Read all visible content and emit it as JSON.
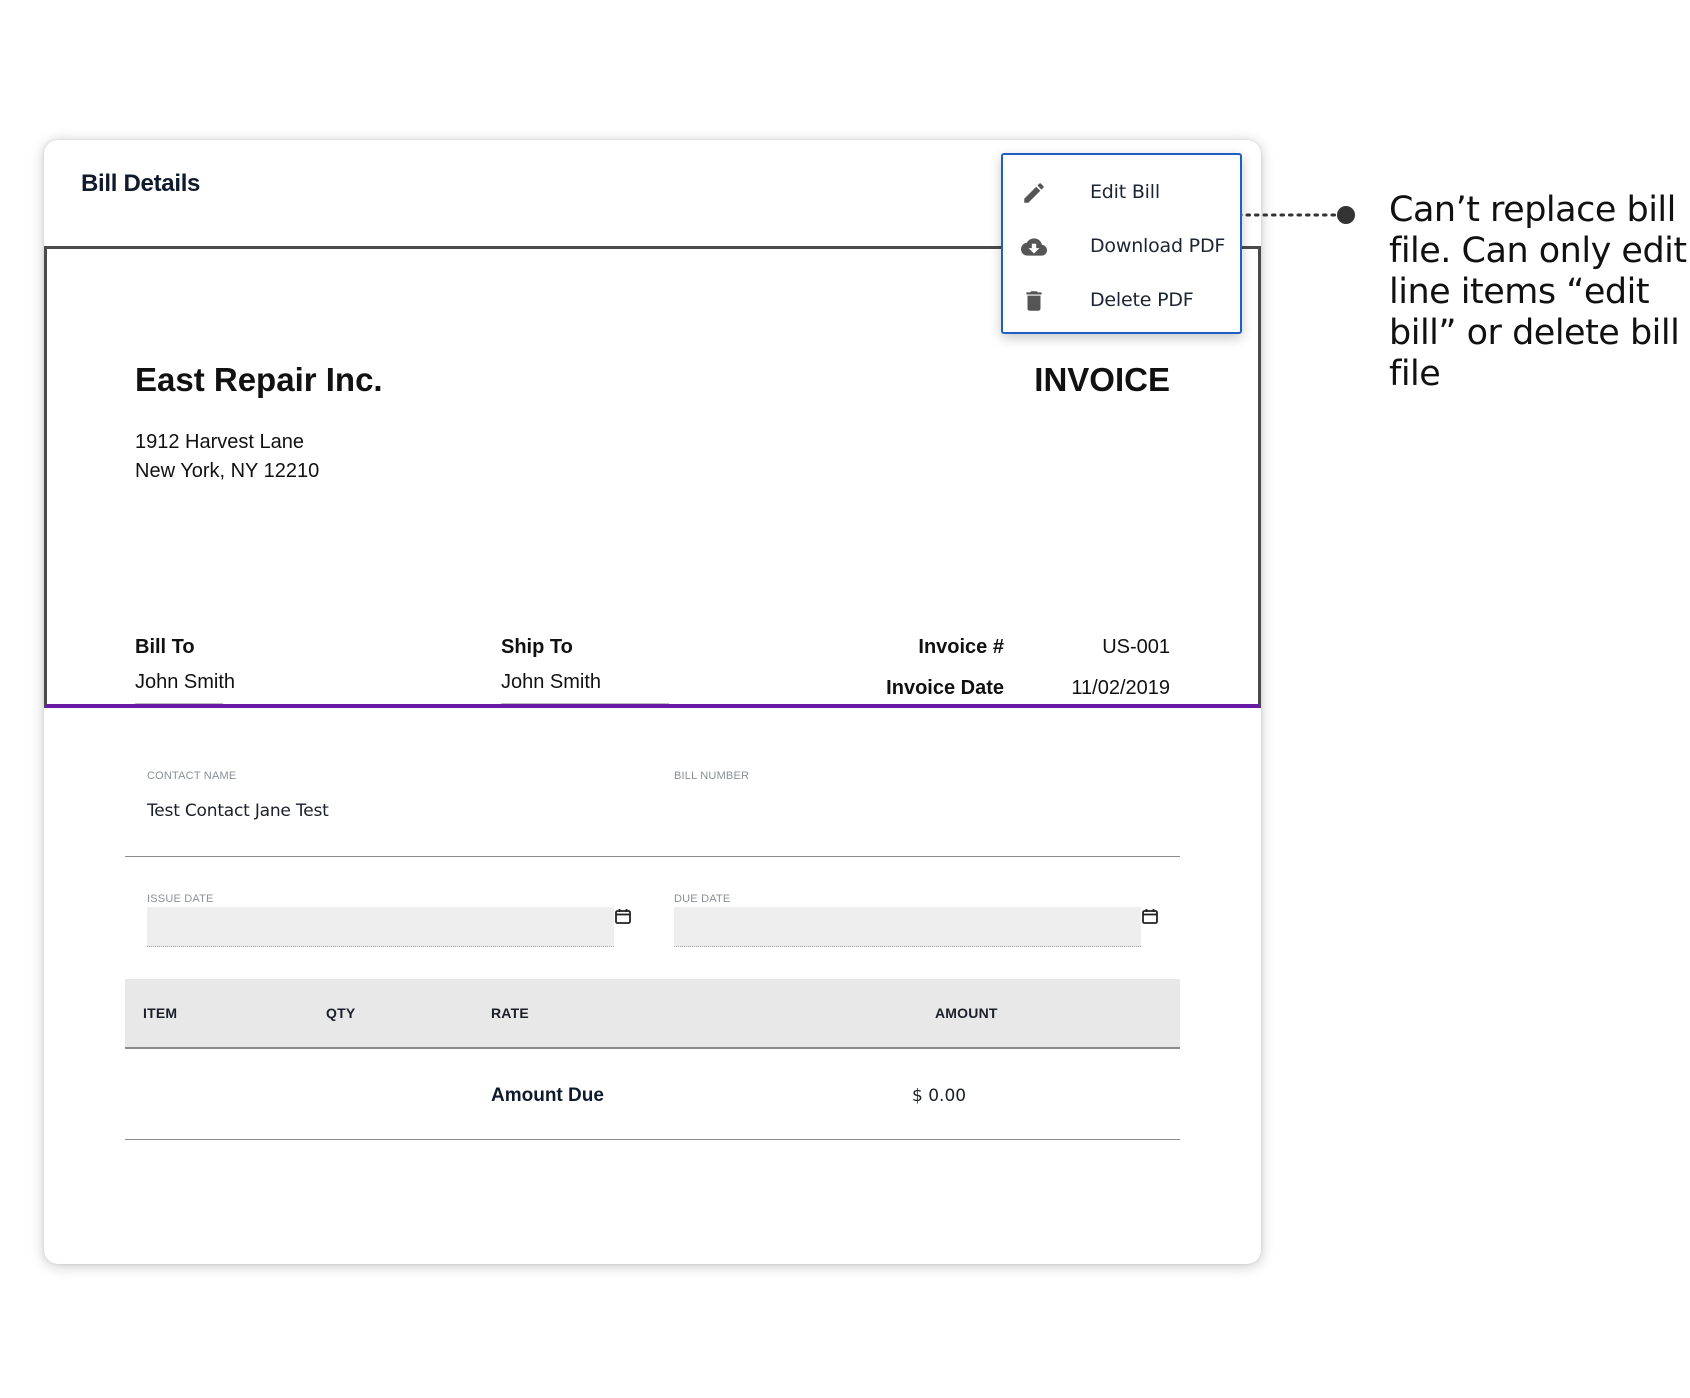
{
  "card": {
    "title": "Bill Details"
  },
  "menu": {
    "items": [
      {
        "label": "Edit Bill",
        "icon": "pencil-icon"
      },
      {
        "label": "Download PDF",
        "icon": "cloud-download-icon"
      },
      {
        "label": "Delete PDF",
        "icon": "trash-icon"
      }
    ],
    "border_color": "#1f5fbf"
  },
  "pdf": {
    "company": "East Repair Inc.",
    "title": "INVOICE",
    "address_line1": "1912 Harvest Lane",
    "address_line2": "New York, NY 12210",
    "bill_to_heading": "Bill To",
    "bill_to_name": "John Smith",
    "ship_to_heading": "Ship To",
    "ship_to_name": "John Smith",
    "invoice_number_label": "Invoice #",
    "invoice_number": "US-001",
    "invoice_date_label": "Invoice Date",
    "invoice_date": "11/02/2019",
    "divider_color": "#6a1ba6"
  },
  "form": {
    "contact_name_label": "CONTACT NAME",
    "contact_name_value": "Test Contact Jane Test",
    "bill_number_label": "BILL NUMBER",
    "bill_number_value": "",
    "issue_date_label": "ISSUE DATE",
    "issue_date_value": "",
    "due_date_label": "DUE DATE",
    "due_date_value": ""
  },
  "table": {
    "columns": [
      "ITEM",
      "QTY",
      "RATE",
      "AMOUNT"
    ],
    "amount_due_label": "Amount Due",
    "amount_due_value": "$ 0.00"
  },
  "annotation": {
    "text": "Can’t replace bill file. Can only edit line items “edit bill” or delete bill file"
  }
}
